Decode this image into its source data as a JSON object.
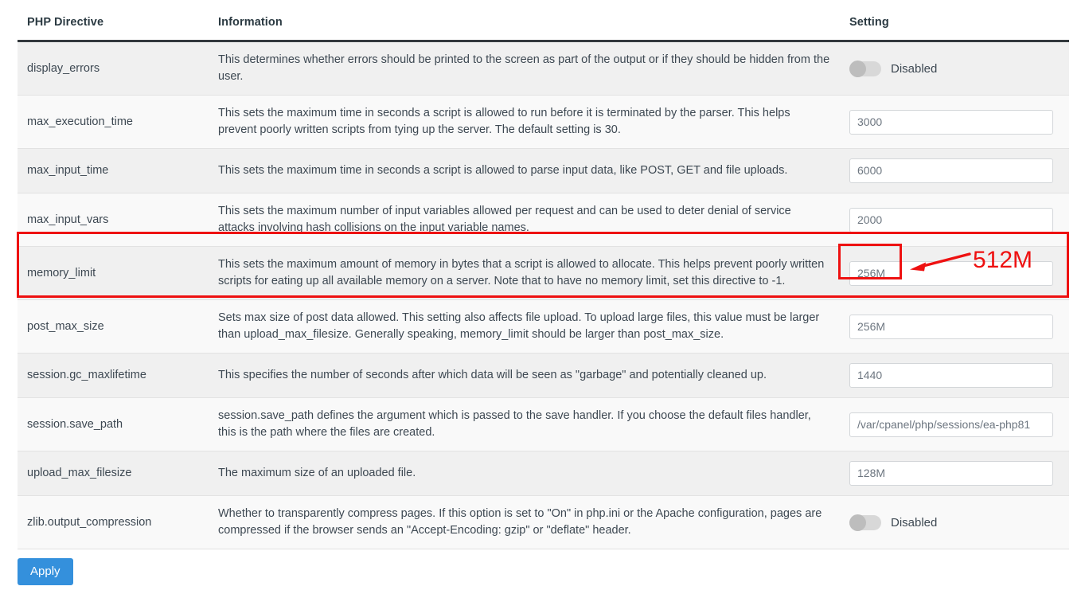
{
  "table": {
    "columns": {
      "directive": "PHP Directive",
      "information": "Information",
      "setting": "Setting"
    },
    "rows": [
      {
        "directive": "display_errors",
        "information": "This determines whether errors should be printed to the screen as part of the output or if they should be hidden from the user.",
        "control": "toggle",
        "toggle_state": "off",
        "toggle_label": "Disabled",
        "value": ""
      },
      {
        "directive": "max_execution_time",
        "information": "This sets the maximum time in seconds a script is allowed to run before it is terminated by the parser. This helps prevent poorly written scripts from tying up the server. The default setting is 30.",
        "control": "text",
        "toggle_state": "",
        "toggle_label": "",
        "value": "3000"
      },
      {
        "directive": "max_input_time",
        "information": "This sets the maximum time in seconds a script is allowed to parse input data, like POST, GET and file uploads.",
        "control": "text",
        "toggle_state": "",
        "toggle_label": "",
        "value": "6000"
      },
      {
        "directive": "max_input_vars",
        "information": "This sets the maximum number of input variables allowed per request and can be used to deter denial of service attacks involving hash collisions on the input variable names.",
        "control": "text",
        "toggle_state": "",
        "toggle_label": "",
        "value": "2000"
      },
      {
        "directive": "memory_limit",
        "information": "This sets the maximum amount of memory in bytes that a script is allowed to allocate. This helps prevent poorly written scripts for eating up all available memory on a server. Note that to have no memory limit, set this directive to -1.",
        "control": "text",
        "toggle_state": "",
        "toggle_label": "",
        "value": "256M"
      },
      {
        "directive": "post_max_size",
        "information": "Sets max size of post data allowed. This setting also affects file upload. To upload large files, this value must be larger than upload_max_filesize. Generally speaking, memory_limit should be larger than post_max_size.",
        "control": "text",
        "toggle_state": "",
        "toggle_label": "",
        "value": "256M"
      },
      {
        "directive": "session.gc_maxlifetime",
        "information": "This specifies the number of seconds after which data will be seen as \"garbage\" and potentially cleaned up.",
        "control": "text",
        "toggle_state": "",
        "toggle_label": "",
        "value": "1440"
      },
      {
        "directive": "session.save_path",
        "information": "session.save_path defines the argument which is passed to the save handler. If you choose the default files handler, this is the path where the files are created.",
        "control": "text",
        "toggle_state": "",
        "toggle_label": "",
        "value": "/var/cpanel/php/sessions/ea-php81"
      },
      {
        "directive": "upload_max_filesize",
        "information": "The maximum size of an uploaded file.",
        "control": "text",
        "toggle_state": "",
        "toggle_label": "",
        "value": "128M"
      },
      {
        "directive": "zlib.output_compression",
        "information": "Whether to transparently compress pages. If this option is set to \"On\" in php.ini or the Apache configuration, pages are compressed if the browser sends an \"Accept-Encoding: gzip\" or \"deflate\" header.",
        "control": "toggle",
        "toggle_state": "off",
        "toggle_label": "Disabled",
        "value": ""
      }
    ]
  },
  "footer": {
    "apply_label": "Apply"
  },
  "annotation": {
    "callout_text": "512M",
    "target_directive": "memory_limit",
    "color": "#ee1111"
  },
  "colors": {
    "accent_button": "#3490dc",
    "row_alt": "#f0f0f0",
    "row_plain": "#f9f9f9",
    "header_rule": "#33393d",
    "annotation_red": "#ee1111"
  }
}
